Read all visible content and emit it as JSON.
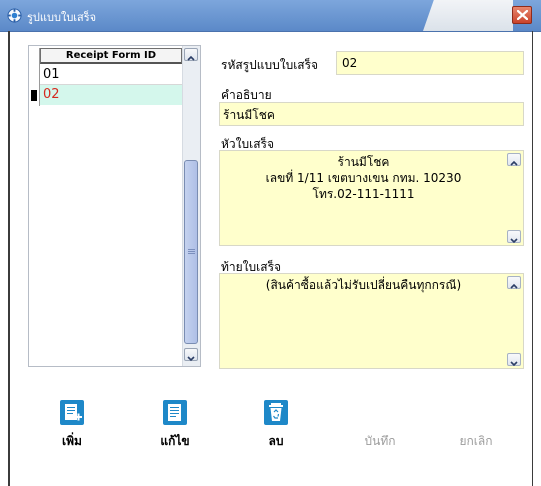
{
  "window": {
    "title": "รูปแบบใบเสร็จ",
    "close_icon": "close-icon"
  },
  "grid": {
    "column_header": "Receipt Form ID",
    "rows": [
      {
        "id": "01",
        "selected": false
      },
      {
        "id": "02",
        "selected": true
      }
    ]
  },
  "form": {
    "code_label": "รหัสรูปแบบใบเสร็จ",
    "code_value": "02",
    "description_label": "คำอธิบาย",
    "description_value": "ร้านมีโชค",
    "header_label": "หัวใบเสร็จ",
    "header_value": "ร้านมีโชค\nเลขที่ 1/11 เขตบางเขน กทม. 10230\nโทร.02-111-1111",
    "footer_label": "ท้ายใบเสร็จ",
    "footer_value": "(สินค้าซื้อแล้วไม่รับเปลี่ยนคืนทุกกรณี)"
  },
  "toolbar": {
    "add": {
      "label": "เพิ่ม",
      "icon": "add-document-icon",
      "enabled": true
    },
    "edit": {
      "label": "แก้ไข",
      "icon": "edit-document-icon",
      "enabled": true
    },
    "delete": {
      "label": "ลบ",
      "icon": "recycle-bin-icon",
      "enabled": true
    },
    "save": {
      "label": "บันทึก",
      "enabled": false
    },
    "cancel": {
      "label": "ยกเลิก",
      "enabled": false
    }
  },
  "colors": {
    "field_background": "#ffffcc",
    "selected_row_background": "#d4f7ec",
    "selected_row_text": "#d42a1f",
    "title_bar": "#5b89c8",
    "close_button": "#c9432b",
    "icon_blue": "#1e88c8"
  }
}
